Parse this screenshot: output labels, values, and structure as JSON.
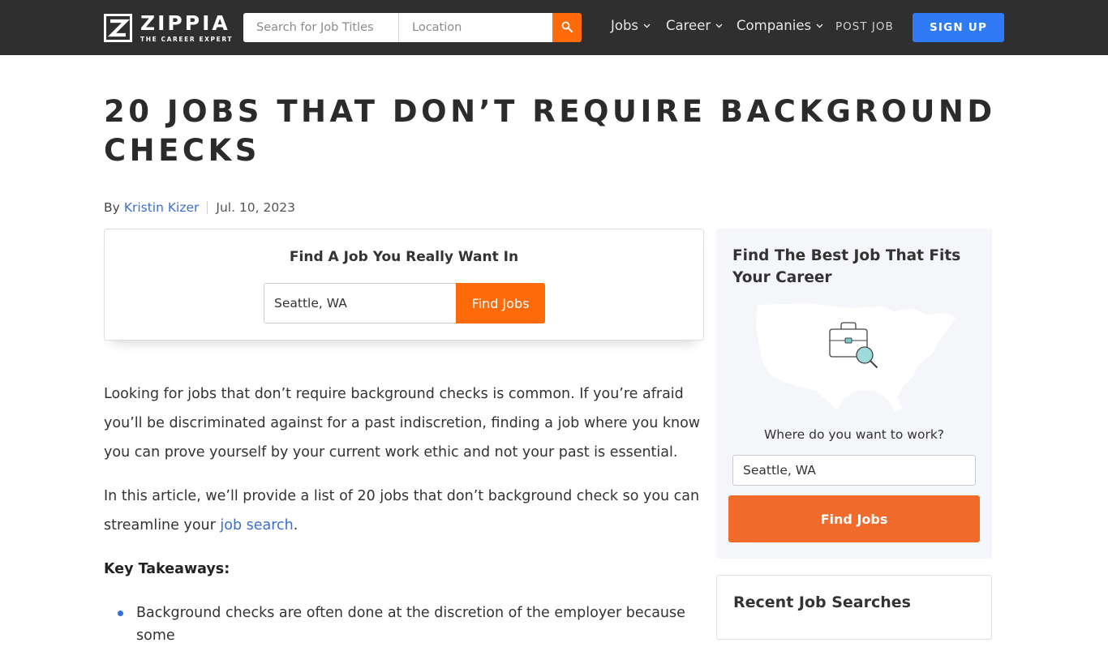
{
  "header": {
    "logo_name": "ZIPPIA",
    "logo_tagline": "THE CAREER EXPERT",
    "search_title_placeholder": "Search for Job Titles",
    "search_location_placeholder": "Location",
    "nav": {
      "jobs": "Jobs",
      "career": "Career",
      "companies": "Companies",
      "post_job": "POST JOB",
      "sign_up": "SIGN UP"
    }
  },
  "article": {
    "title": "20 JOBS THAT DON’T REQUIRE BACKGROUND CHECKS",
    "by_label": "By",
    "author": "Kristin Kizer",
    "date": "Jul. 10, 2023",
    "find_box": {
      "title": "Find A Job You Really Want In",
      "location_value": "Seattle, WA",
      "button": "Find Jobs"
    },
    "paragraph_1": "Looking for jobs that don’t require background checks is common. If you’re afraid you’ll be discriminated against for a past indiscretion, finding a job where you know you can prove yourself by your current work ethic and not your past is essential.",
    "paragraph_2_before_link": "In this article, we’ll provide a list of 20 jobs that don’t background check so you can streamline your ",
    "paragraph_2_link": "job search",
    "paragraph_2_after_link": ".",
    "key_takeaways_label": "Key Takeaways:",
    "takeaways": [
      "Background checks are often done at the discretion of the employer because some"
    ]
  },
  "sidebar": {
    "card_title": "Find The Best Job That Fits Your Career",
    "question": "Where do you want to work?",
    "location_value": "Seattle, WA",
    "button": "Find Jobs",
    "recent_title": "Recent Job Searches"
  },
  "colors": {
    "header_bg": "#2f2f2f",
    "accent_orange": "#ff6b0a",
    "signup_blue": "#2f7bf5",
    "link_blue": "#3a6fd0",
    "sidebar_bg": "#f4f6fa"
  },
  "icons": {
    "logo": "zippia-z-logo-icon",
    "search": "search-icon",
    "chevron": "chevron-down-icon",
    "map": "usa-map-briefcase-icon"
  }
}
